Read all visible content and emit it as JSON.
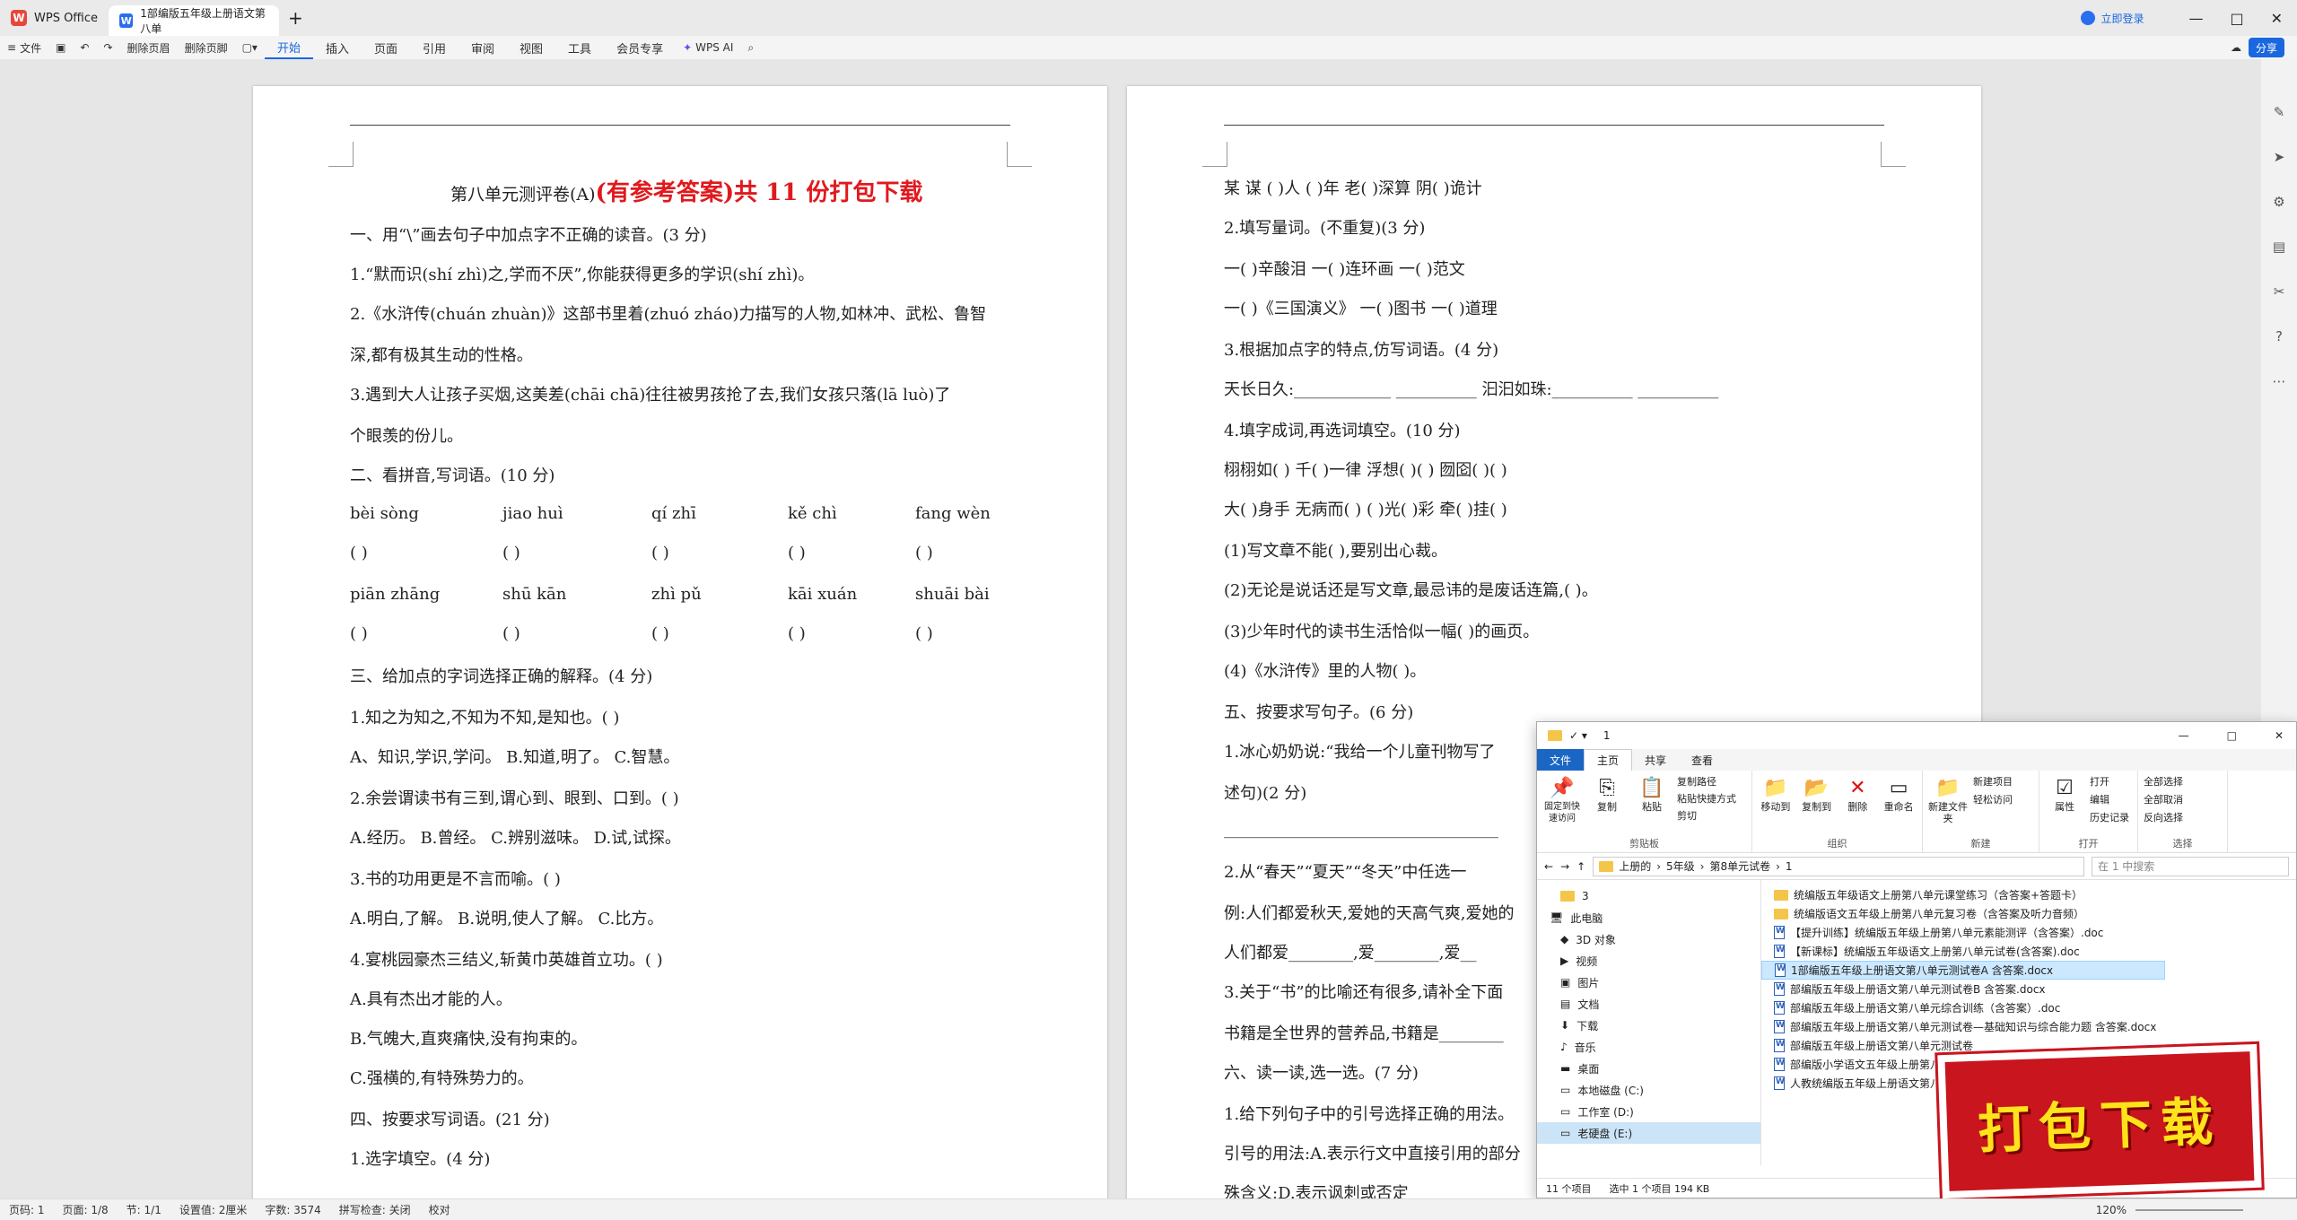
{
  "titlebar": {
    "app_tab": "WPS Office",
    "doc_tab": "1部编版五年级上册语文第八单",
    "login": "立即登录"
  },
  "toolbar": {
    "file": "文件",
    "undo_page": "删除页眉",
    "delete_footer": "删除页脚",
    "menus": [
      "开始",
      "插入",
      "页面",
      "引用",
      "审阅",
      "视图",
      "工具",
      "会员专享"
    ],
    "wps_ai": "WPS AI",
    "share": "分享"
  },
  "left_page": {
    "title_plain": "第八单元测评卷(A)",
    "title_red": "(有参考答案)共 11 份打包下载",
    "lines": [
      "一、用“\\”画去句子中加点字不正确的读音。(3 分)",
      "1.“默而识(shí zhì)之,学而不厌”,你能获得更多的学识(shí zhì)。",
      "2.《水浒传(chuán zhuàn)》这部书里着(zhuó zháo)力描写的人物,如林冲、武松、鲁智",
      "深,都有极其生动的性格。",
      "3.遇到大人让孩子买烟,这美差(chāi chā)往往被男孩抢了去,我们女孩只落(lā luò)了",
      "个眼羡的份儿。",
      "二、看拼音,写词语。(10 分)"
    ],
    "pinyin_row1": [
      "bèi  sòng",
      "jiao  huì",
      "qí  zhī",
      "kě  chì",
      "fang  wèn"
    ],
    "pinyin_row2": [
      "piān  zhāng",
      "shū  kān",
      "zhì  pǔ",
      "kāi  xuán",
      "shuāi  bài"
    ],
    "blank": "(          )",
    "lines2": [
      "三、给加点的字词选择正确的解释。(4 分)",
      "1.知之为知之,不知为不知,是知也。(    )",
      "A、知识,学识,学问。          B.知道,明了。            C.智慧。",
      "2.余尝谓读书有三到,谓心到、眼到、口到。(    )",
      "A.经历。          B.曾经。          C.辨别滋味。          D.试,试探。",
      "3.书的功用更是不言而喻。(    )",
      "A.明白,了解。                  B.说明,使人了解。          C.比方。",
      "4.宴桃园豪杰三结义,斩黄巾英雄首立功。(    )",
      "A.具有杰出才能的人。",
      "B.气魄大,直爽痛快,没有拘束的。",
      "C.强横的,有特殊势力的。",
      "四、按要求写词语。(21 分)",
      "1.选字填空。(4 分)"
    ]
  },
  "right_page": {
    "lines": [
      "某    谋      (    )人              (    )年                老(    )深算              阴(    )诡计",
      "2.填写量词。(不重复)(3 分)",
      "一(    )辛酸泪                        一(    )连环画                        一(    )范文",
      "一(    )《三国演义》                一(    )图书                            一(    )道理",
      "3.根据加点字的特点,仿写词语。(4 分)",
      "天长日久:____________      __________          汩汩如珠:__________      __________",
      "4.填字成词,再选词填空。(10 分)",
      "栩栩如(    )              千(    )一律              浮想(    )(    )              囫囵(    )(    )",
      "大(    )身手              无病而(    )              (    )光(    )彩              牵(    )挂(    )",
      "(1)写文章不能(    ),要别出心裁。",
      "(2)无论是说话还是写文章,最忌讳的是废话连篇,(    )。",
      "(3)少年时代的读书生活恰似一幅(    )的画页。",
      "(4)《水浒传》里的人物(    )。",
      "五、按要求写句子。(6 分)",
      "1.冰心奶奶说:“我给一个儿童刊物写了",
      "述句)(2 分)",
      "__________________________________",
      "2.从“春天”“夏天”“冬天”中任选一",
      "例:人们都爱秋天,爱她的天高气爽,爱她的",
      "人们都爱________,爱________,爱__",
      "3.关于“书”的比喻还有很多,请补全下面",
      "书籍是全世界的营养品,书籍是________",
      "六、读一读,选一选。(7 分)",
      "1.给下列句子中的引号选择正确的用法。",
      "引号的用法:A.表示行文中直接引用的部分",
      "殊含义;D.表示讽刺或否定"
    ]
  },
  "explorer": {
    "title": "1",
    "tabs": [
      "文件",
      "主页",
      "共享",
      "查看"
    ],
    "ribbon": {
      "pin": "固定到快速访问",
      "copy": "复制",
      "paste": "粘贴",
      "copy_path": "复制路径",
      "paste_shortcut": "粘贴快捷方式",
      "cut": "剪切",
      "clipboard": "剪贴板",
      "move_to": "移动到",
      "copy_to": "复制到",
      "delete": "删除",
      "rename": "重命名",
      "organize": "组织",
      "new_folder": "新建文件夹",
      "new_item": "新建项目",
      "easy_access": "轻松访问",
      "new": "新建",
      "properties": "属性",
      "open": "打开",
      "edit": "编辑",
      "history": "历史记录",
      "open_group": "打开",
      "select_all": "全部选择",
      "select_none": "全部取消",
      "invert": "反向选择",
      "select": "选择"
    },
    "path": [
      "上册的",
      "5年级",
      "第8单元试卷",
      "1"
    ],
    "search": "在 1 中搜索",
    "nav": [
      "3",
      "此电脑",
      "3D 对象",
      "视频",
      "图片",
      "文档",
      "下载",
      "音乐",
      "桌面",
      "本地磁盘 (C:)",
      "工作室 (D:)",
      "老硬盘 (E:)"
    ],
    "files": [
      "统编版五年级语文上册第八单元课堂练习（含答案+答题卡）",
      "统编版语文五年级上册第八单元复习卷（含答案及听力音频）",
      "【提升训练】统编版五年级上册第八单元素能测评（含答案）.doc",
      "【新课标】统编版五年级语文上册第八单元试卷(含答案).doc",
      "1部编版五年级上册语文第八单元测试卷A    含答案.docx",
      "部编版五年级上册语文第八单元测试卷B    含答案.docx",
      "部编版五年级上册语文第八单元综合训练（含答案）.doc",
      "部编版五年级上册语文第八单元测试卷—基础知识与综合能力题    含答案.docx",
      "部编版五年级上册语文第八单元测试卷",
      "部编版小学语文五年级上册第八",
      "人教统编版五年级上册语文第八"
    ],
    "status": [
      "11 个项目",
      "选中 1 个项目  194 KB"
    ]
  },
  "statusbar": {
    "items": [
      "页码: 1",
      "页面: 1/8",
      "节: 1/1",
      "设置值: 2厘米",
      "字数: 3574",
      "拼写检查: 关闭",
      "校对"
    ],
    "zoom": "120%"
  },
  "badge": {
    "text": "打包下载"
  }
}
